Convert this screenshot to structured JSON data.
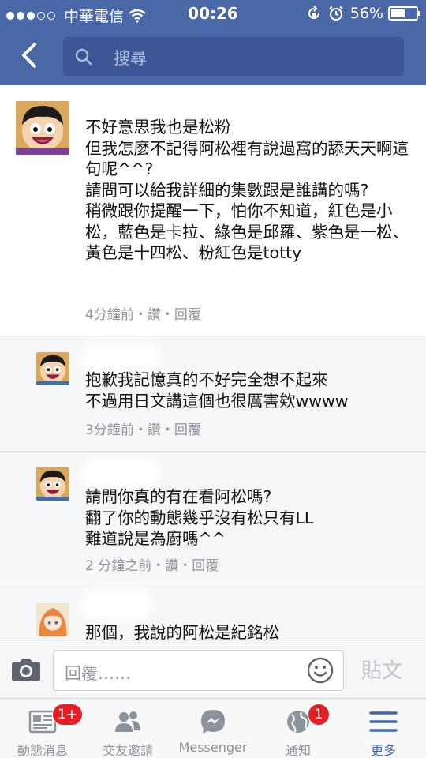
{
  "status_bar": {
    "carrier": "中華電信",
    "time": "00:26",
    "battery_pct": "56%",
    "battery_level": 0.56
  },
  "search": {
    "placeholder": "搜尋"
  },
  "comments": [
    {
      "text": "不好意思我也是松粉\n但我怎麼不記得阿松裡有說過窩的舔天天啊這句呢^^?\n請問可以給我詳細的集數跟是誰講的嗎?\n稍微跟你提醒一下，怕你不知道，紅色是小松，藍色是卡拉、綠色是邱羅、紫色是一松、黃色是十四松、粉紅色是totty",
      "meta": "4分鐘前・讚・回覆"
    },
    {
      "text": "抱歉我記憶真的不好完全想不起來\n不過用日文講這個也很厲害欸wwww",
      "meta": "3分鐘前・讚・回覆"
    },
    {
      "text": "請問你真的有在看阿松嗎?\n翻了你的動態幾乎沒有松只有LL\n難道說是為廚嗎^^",
      "meta": "2 分鐘之前・讚・回覆"
    },
    {
      "text": "那個，我說的阿松是紀銘松",
      "meta": ""
    }
  ],
  "composer": {
    "placeholder": "回覆……",
    "post_label": "貼文"
  },
  "tabs": [
    {
      "label": "動態消息",
      "badge": "1+",
      "icon": "news-feed-icon"
    },
    {
      "label": "交友邀請",
      "badge": "",
      "icon": "friends-icon"
    },
    {
      "label": "Messenger",
      "badge": "",
      "icon": "messenger-icon"
    },
    {
      "label": "通知",
      "badge": "1",
      "icon": "globe-icon"
    },
    {
      "label": "更多",
      "badge": "",
      "icon": "menu-icon"
    }
  ],
  "colors": {
    "header": "#4a67a8",
    "accent": "#4267b2",
    "badge": "#e41e25"
  }
}
